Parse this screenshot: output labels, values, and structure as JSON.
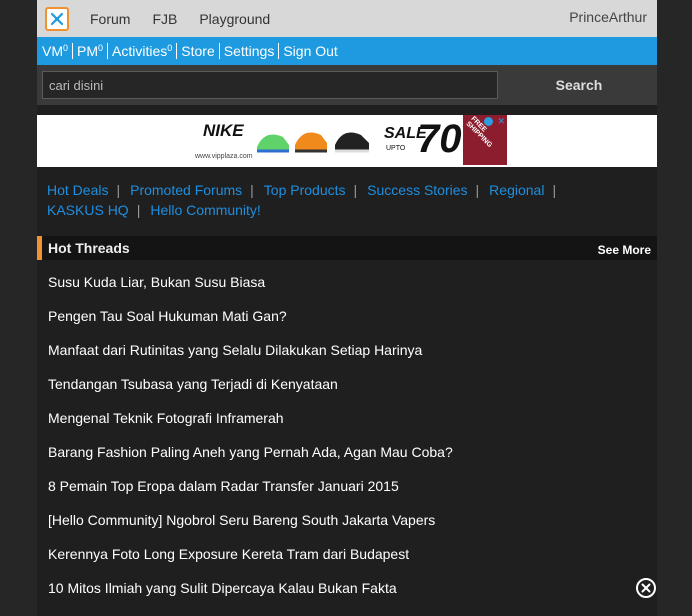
{
  "topbar": {
    "logo_icon": "kaskus-logo-icon",
    "nav": [
      "Forum",
      "FJB",
      "Playground"
    ],
    "username": "PrinceArthur"
  },
  "userbar": {
    "vm_label": "VM",
    "vm_count": "0",
    "pm_label": "PM",
    "pm_count": "0",
    "activities_label": "Activities",
    "activities_count": "0",
    "store": "Store",
    "settings": "Settings",
    "signout": "Sign Out"
  },
  "search": {
    "value": "cari disini",
    "button": "Search"
  },
  "ad": {
    "brand": "NIKE",
    "url": "www.vipplaza.com",
    "sale": "SALE",
    "upto": "UPTO",
    "percent": "70",
    "corner": "FREE SHIPPING"
  },
  "links": [
    "Hot Deals",
    "Promoted Forums",
    "Top Products",
    "Success Stories",
    "Regional",
    "KASKUS HQ",
    "Hello Community!"
  ],
  "hot_threads": {
    "title": "Hot Threads",
    "see_more": "See More",
    "items": [
      "Susu Kuda Liar, Bukan Susu Biasa",
      "Pengen Tau Soal Hukuman Mati Gan?",
      "Manfaat dari Rutinitas yang Selalu Dilakukan Setiap Harinya",
      "Tendangan Tsubasa yang Terjadi di Kenyataan",
      "Mengenal Teknik Fotografi Inframerah",
      "Barang Fashion Paling Aneh yang Pernah Ada, Agan Mau Coba?",
      "8 Pemain Top Eropa dalam Radar Transfer Januari 2015",
      "[Hello Community] Ngobrol Seru Bareng South Jakarta Vapers",
      "Kerennya Foto Long Exposure Kereta Tram dari Budapest",
      "10 Mitos Ilmiah yang Sulit Dipercaya Kalau Bukan Fakta"
    ]
  },
  "close_icon": "close-circle-icon",
  "colors": {
    "blue": "#1e9be0",
    "orange": "#f0922f",
    "bg": "#262626"
  }
}
